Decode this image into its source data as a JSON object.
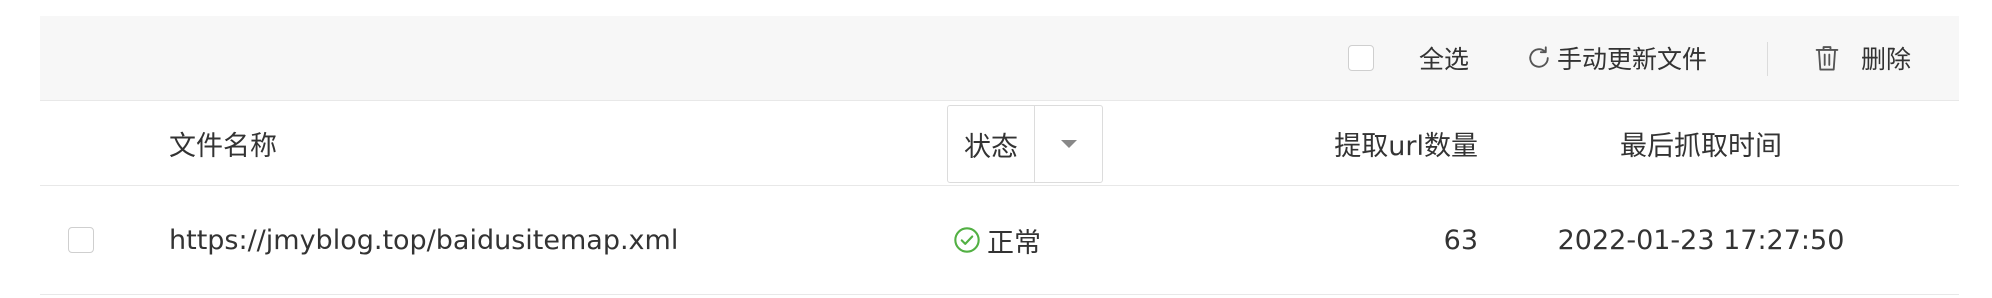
{
  "toolbar": {
    "select_all_label": "全选",
    "refresh_label": "手动更新文件",
    "delete_label": "删除"
  },
  "table": {
    "columns": {
      "filename": "文件名称",
      "status": "状态",
      "url_count": "提取url数量",
      "last_crawl": "最后抓取时间"
    },
    "rows": [
      {
        "filename": "https://jmyblog.top/baidusitemap.xml",
        "status": "正常",
        "url_count": "63",
        "last_crawl": "2022-01-23 17:27:50"
      }
    ]
  },
  "colors": {
    "status_ok": "#52b043",
    "border": "#e8e8e8",
    "toolbar_bg": "#f7f7f7"
  },
  "icons": [
    "refresh-icon",
    "trash-icon",
    "chevron-down-icon",
    "check-circle-icon"
  ]
}
